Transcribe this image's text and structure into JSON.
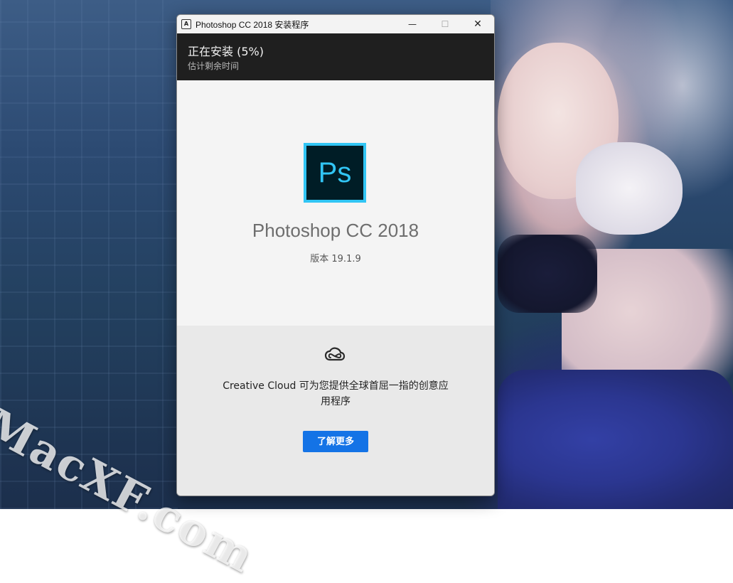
{
  "window": {
    "title": "Photoshop CC 2018 安装程序",
    "app_icon": "adobe-icon",
    "app_icon_glyph": "A",
    "controls": {
      "minimize": "—",
      "maximize": "☐",
      "close": "✕"
    }
  },
  "progress": {
    "status": "正在安装 (5%)",
    "subtitle": "估计剩余时间",
    "percent": 5,
    "accent_color": "#1a73e8"
  },
  "product": {
    "logo_text": "Ps",
    "logo_colors": {
      "border": "#31c5f4",
      "background": "#001d26"
    },
    "name": "Photoshop CC 2018",
    "version": "版本 19.1.9"
  },
  "promo": {
    "icon": "creative-cloud-icon",
    "text": "Creative Cloud 可为您提供全球首屈一指的创意应用程序",
    "button_label": "了解更多",
    "button_color": "#1473e6"
  },
  "watermark": {
    "text": "MacXF.com"
  }
}
